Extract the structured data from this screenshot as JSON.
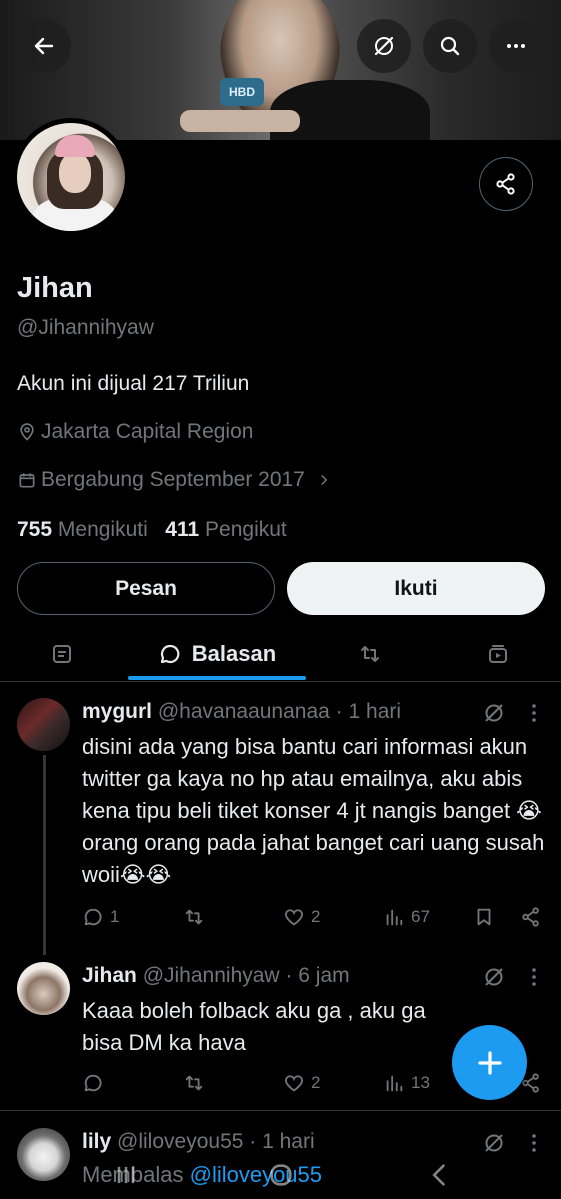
{
  "profile": {
    "name": "Jihan",
    "handle": "@Jihannihyaw",
    "bio": "Akun ini dijual 217 Triliun",
    "location": "Jakarta Capital Region",
    "joined": "Bergabung September 2017",
    "following_count": "755",
    "following_label": "Mengikuti",
    "followers_count": "411",
    "followers_label": "Pengikut"
  },
  "banner": {
    "cake_text": "HBD"
  },
  "header_icons": [
    "back-arrow-icon",
    "grok-icon",
    "search-icon",
    "more-icon"
  ],
  "buttons": {
    "message": "Pesan",
    "follow": "Ikuti"
  },
  "tabs": {
    "active_label": "Balasan"
  },
  "posts": [
    {
      "author": "mygurl",
      "handle": "@havanaaunanaa",
      "time": "· 1 hari",
      "text": "disini ada yang bisa bantu cari informasi akun twitter ga kaya no hp atau emailnya, aku abis kena tipu beli tiket konser 4 jt nangis banget 😭 orang orang pada jahat banget cari uang susah woii😭😭",
      "replies": "1",
      "reposts": "",
      "likes": "2",
      "views": "67"
    },
    {
      "author": "Jihan",
      "handle": "@Jihannihyaw",
      "time": "· 6 jam",
      "text": "Kaaa boleh folback aku ga , aku ga bisa DM ka hava",
      "replies": "",
      "reposts": "",
      "likes": "2",
      "views": "13"
    },
    {
      "author": "lily",
      "handle": "@liloveyou55",
      "time": "· 1 hari",
      "replying_prefix": "Membalas",
      "replying_to": "@liloveyou55"
    }
  ],
  "colors": {
    "accent": "#1d9bf0",
    "background": "#000000",
    "muted": "#71767b",
    "text": "#e7e9ea"
  }
}
